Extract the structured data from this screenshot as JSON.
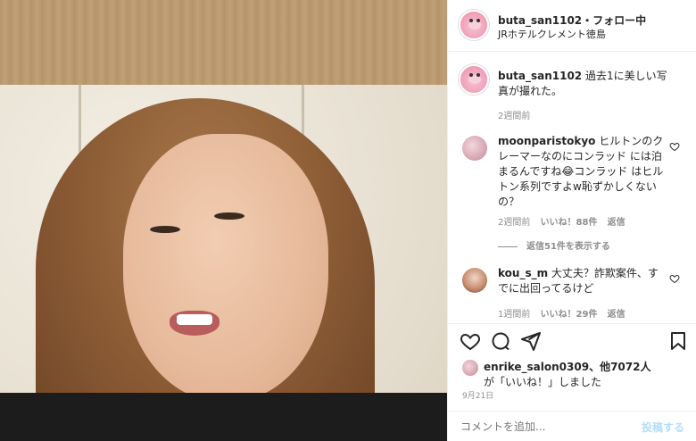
{
  "header": {
    "username": "buta_san1102",
    "separator": "・",
    "follow_status": "フォロー中",
    "location": "JRホテルクレメント徳島"
  },
  "caption": {
    "username": "buta_san1102",
    "text": "過去1に美しい写真が撮れた。",
    "time": "2週間前"
  },
  "comments": [
    {
      "username": "moonparistokyo",
      "text": "ヒルトンのクレーマーなのにコンラッド には泊まるんですね😂コンラッド はヒルトン系列ですよw恥ずかしくないの？",
      "time": "2週間前",
      "likes": "いいね！88件",
      "reply": "返信",
      "view_replies": "返信51件を表示する"
    },
    {
      "username": "kou_s_m",
      "text": "大丈夫？詐欺案件、すでに出回ってるけど",
      "time": "1週間前",
      "likes": "いいね！29件",
      "reply": "返信"
    }
  ],
  "likes_line": {
    "user": "enrike_salon0309",
    "others": "、他7072人",
    "suffix": "が「いいね！」しました"
  },
  "post_date": "9月21日",
  "comment_input": {
    "placeholder": "コメントを追加...",
    "post_label": "投稿する"
  },
  "icons": {
    "like": "heart-icon",
    "comment": "comment-icon",
    "share": "share-icon",
    "save": "bookmark-icon"
  }
}
